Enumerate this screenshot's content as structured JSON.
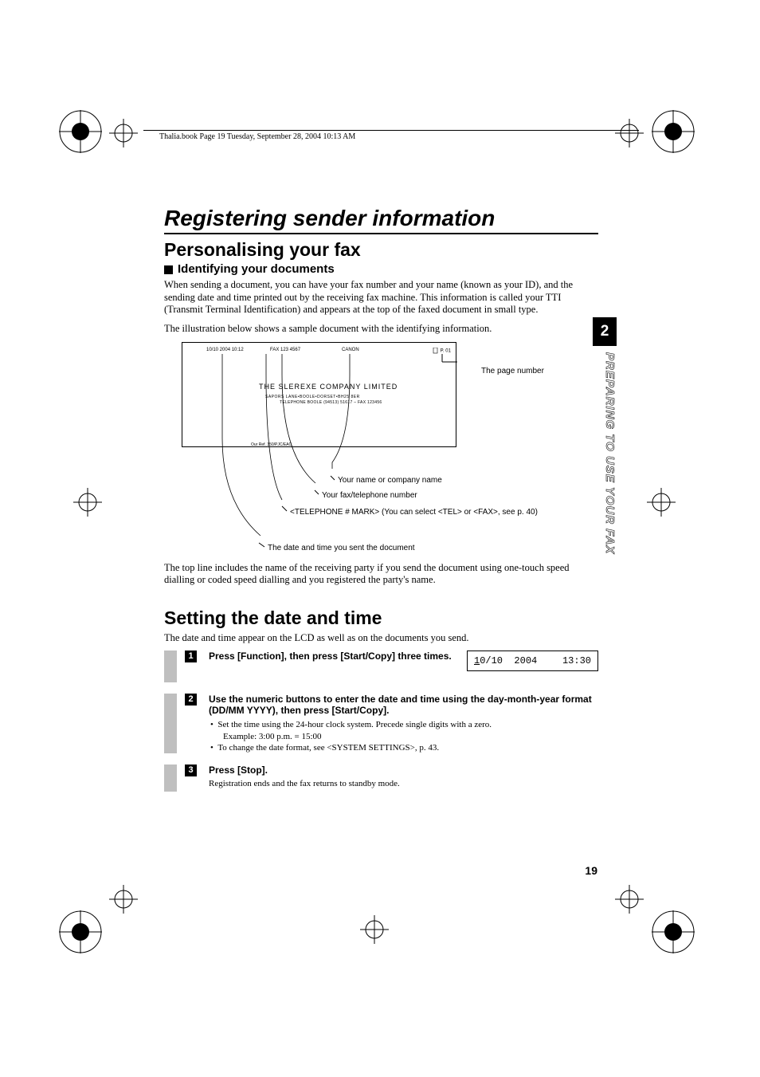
{
  "header": {
    "text": "Thalia.book  Page 19  Tuesday, September 28, 2004  10:13 AM"
  },
  "section_title": "Registering sender information",
  "personalising": {
    "title": "Personalising your fax",
    "identifying": {
      "title": "Identifying your documents",
      "p1": "When sending a document, you can have your fax number and your name (known as your ID), and the sending date and time printed out by the receiving fax machine. This information is called your TTI (Transmit Terminal Identification) and appears at the top of the faxed document in small type.",
      "p2": "The illustration below shows a sample document with the identifying information."
    }
  },
  "illustration": {
    "date": "10/10 2004 10:12",
    "fax": "FAX 123 4567",
    "brand": "CANON",
    "page_mark": "P. 01",
    "company": "THE SLEREXE COMPANY LIMITED",
    "addr": "SAPORS LANE•BOOLE•DORSET•BH25 8ER",
    "tel": "TELEPHONE BOOLE (94513) 51617 – FAX 123456",
    "ref": "Our Ref. 350/PJC/EAC"
  },
  "callouts": {
    "page_number": "The page number",
    "name": "Your name or company name",
    "faxtel": "Your fax/telephone number",
    "mark": "<TELEPHONE # MARK> (You can select <TEL> or <FAX>, see p. 40)",
    "datetime": "The date and time you sent the document"
  },
  "after_illus": "The top line includes the name of the receiving party if you send the document using one-touch speed dialling or coded speed dialling and you registered the party's name.",
  "setting": {
    "title": "Setting the date and time",
    "intro": "The date and time appear on the LCD as well as on the documents you send.",
    "steps": [
      {
        "num": "1",
        "head": "Press [Function], then press [Start/Copy] three times.",
        "lcd_left": "10/10  2004",
        "lcd_right": "13:30"
      },
      {
        "num": "2",
        "head": "Use the numeric buttons to enter the date and time using the day-month-year format (DD/MM YYYY), then press [Start/Copy].",
        "bullets": [
          "Set the time using the 24-hour clock system. Precede single digits with a zero.",
          "Example: 3:00 p.m. = 15:00",
          "To change the date format, see <SYSTEM SETTINGS>, p. 43."
        ]
      },
      {
        "num": "3",
        "head": "Press [Stop].",
        "body": "Registration ends and the fax returns to standby mode."
      }
    ]
  },
  "sidebar": {
    "chapter": "2",
    "label": "PREPARING TO USE YOUR FAX"
  },
  "page_num": "19"
}
